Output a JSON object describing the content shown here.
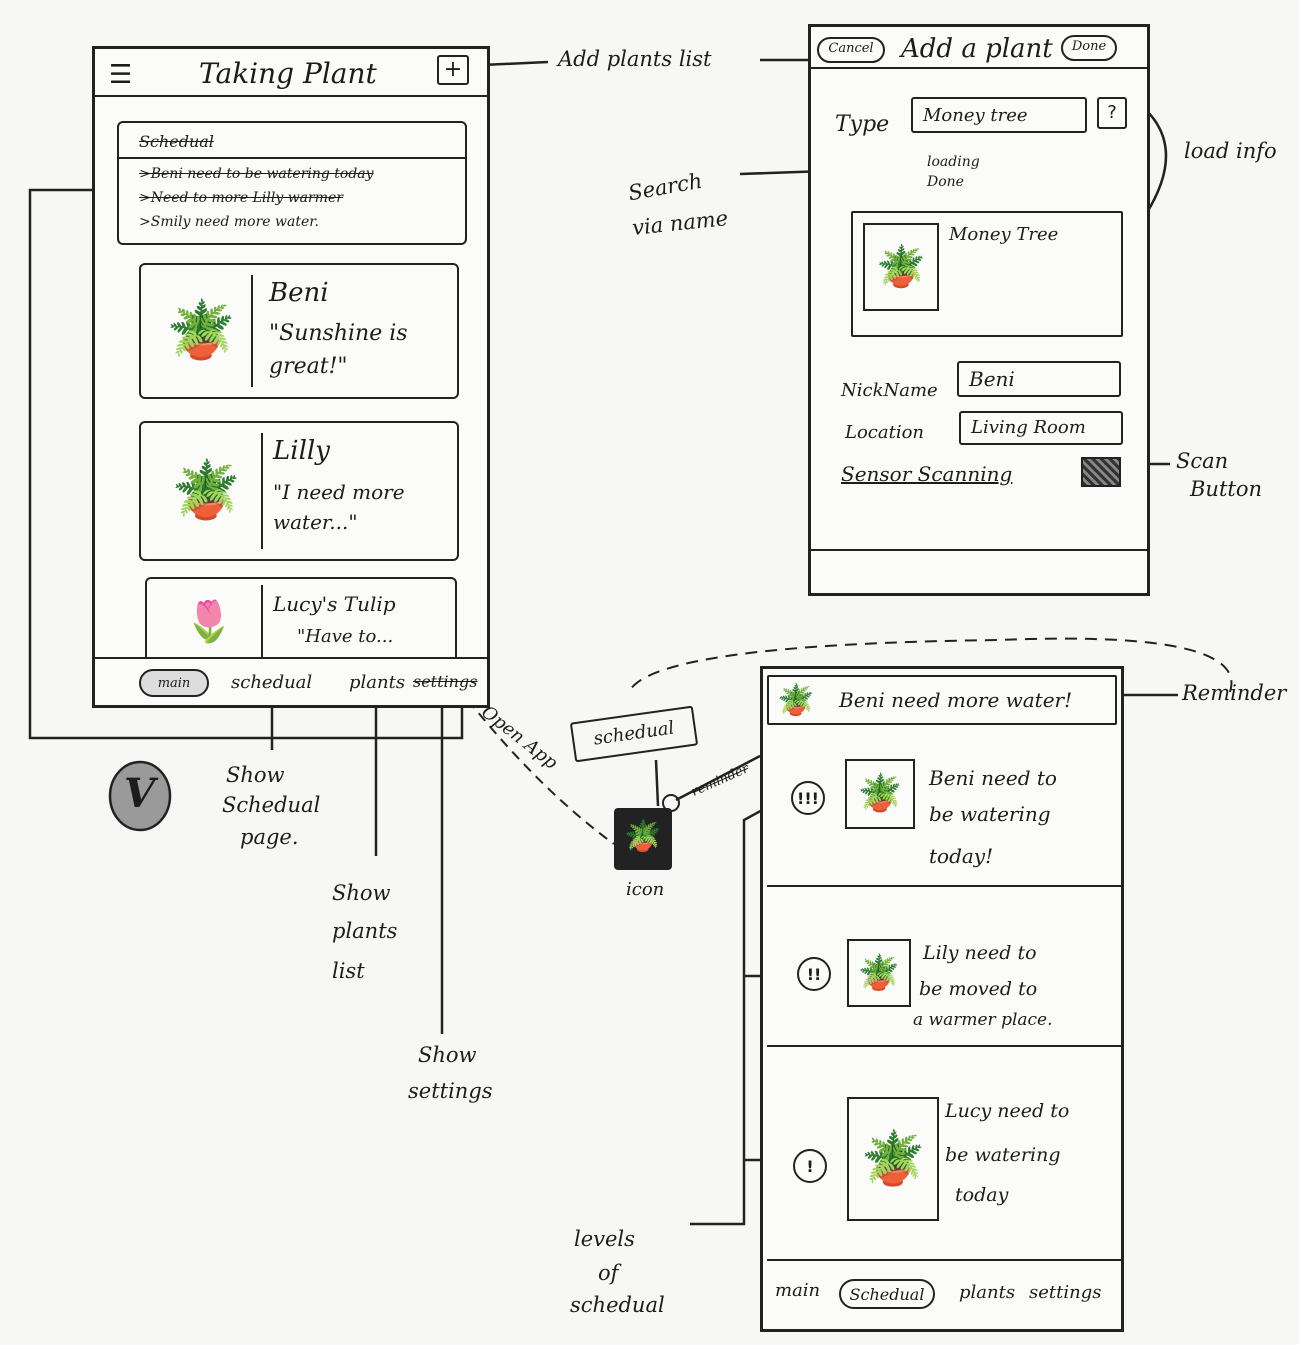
{
  "main_screen": {
    "title": "Taking Plant",
    "menu_icon": "hamburger-menu-icon",
    "add_button": "+",
    "schedule": {
      "heading": "Schedual",
      "items": [
        ">Beni need to be watering today",
        ">Need to more Lilly warmer",
        ">Smily need more water."
      ]
    },
    "plants": [
      {
        "name": "Beni",
        "message": "\"Sunshine is great!\""
      },
      {
        "name": "Lilly",
        "message": "\"I need more water...\""
      },
      {
        "name": "Lucy's Tulip",
        "message": "\"Have to..."
      }
    ],
    "tabs": [
      "main",
      "schedual",
      "plants",
      "settings"
    ]
  },
  "add_plant_screen": {
    "cancel": "Cancel",
    "title": "Add a plant",
    "done": "Done",
    "type_label": "Type",
    "type_value": "Money tree",
    "help_button": "?",
    "loading_text": "loading Done",
    "result_title": "Money Tree",
    "nickname_label": "NickName",
    "nickname_value": "Beni",
    "location_label": "Location",
    "location_value": "Living Room",
    "sensor_label": "Sensor Scanning"
  },
  "schedule_screen": {
    "reminder": "Beni need more water!",
    "items": [
      {
        "level": "!!!",
        "text": [
          "Beni need to",
          "be watering",
          "today!"
        ]
      },
      {
        "level": "!!",
        "text": [
          "Lily need to",
          "be moved to",
          "a warmer place."
        ]
      },
      {
        "level": "!",
        "text": [
          "Lucy need to",
          "be watering",
          "today"
        ]
      }
    ],
    "tabs": [
      "main",
      "Schedual",
      "plants",
      "settings"
    ]
  },
  "annotations": {
    "add_plants_list": "Add plants list",
    "load_info": "load info",
    "search_via_name": [
      "Search",
      "via name"
    ],
    "scan_button": [
      "Scan",
      "Button"
    ],
    "reminder": "Reminder",
    "open_app": "Open App",
    "reminder_small": "reminder",
    "schedual_tag": "schedual",
    "icon_label": "icon",
    "show_schedual_page": [
      "Show",
      "Schedual",
      "page."
    ],
    "show_plants_list": [
      "Show",
      "plants",
      "list"
    ],
    "show_settings": [
      "Show",
      "settings"
    ],
    "levels_of_schedual": [
      "levels",
      "of",
      "schedual"
    ],
    "check_mark": "V"
  }
}
